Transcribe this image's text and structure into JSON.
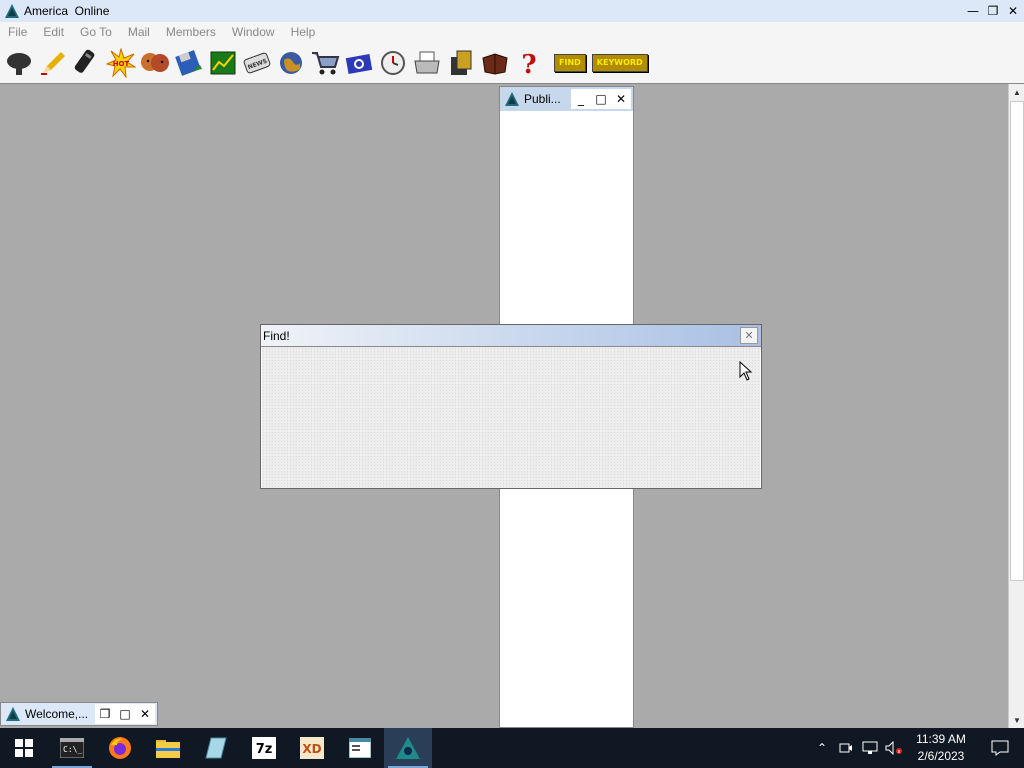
{
  "app": {
    "title": "America  Online"
  },
  "menu": [
    "File",
    "Edit",
    "Go To",
    "Mail",
    "Members",
    "Window",
    "Help"
  ],
  "toolbar": {
    "find_label": "FIND",
    "keyword_label": "KEYWORD",
    "icons": [
      "chat-icon",
      "pencil-icon",
      "phone-icon",
      "hot-icon",
      "people-icon",
      "disk-icon",
      "chart-icon",
      "news-icon",
      "globe-icon",
      "cart-icon",
      "camera-icon",
      "clock-icon",
      "printer-icon",
      "coins-icon",
      "book-icon",
      "help-icon"
    ]
  },
  "publi_window": {
    "title": "Publi..."
  },
  "find_dialog": {
    "title": "Find!"
  },
  "welcome_window": {
    "title": "Welcome,..."
  },
  "taskbar": {
    "time": "11:39 AM",
    "date": "2/6/2023"
  },
  "colors": {
    "mdi_bg": "#aaaaaa",
    "taskbar_bg": "#101824",
    "titlebar_bg": "#dce8f7"
  }
}
